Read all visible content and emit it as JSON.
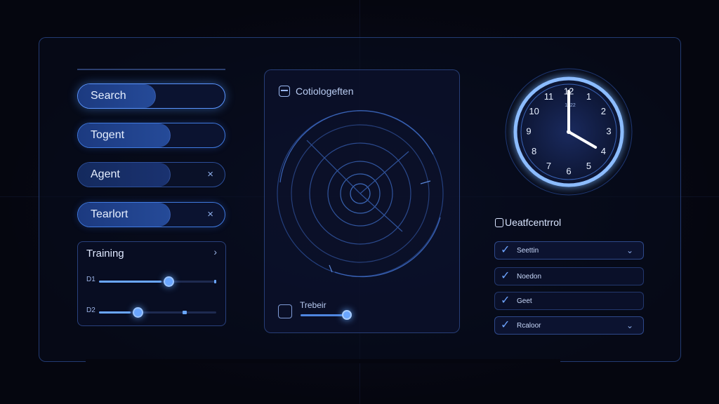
{
  "left": {
    "pills": [
      {
        "label": "Search",
        "fill_pct": 53,
        "close": ""
      },
      {
        "label": "Togent",
        "fill_pct": 63,
        "close": ""
      },
      {
        "label": "Agent",
        "fill_pct": 63,
        "close": "×"
      },
      {
        "label": "Tearlort",
        "fill_pct": 63,
        "close": "×"
      }
    ],
    "training": {
      "title": "Training",
      "chevron": "›",
      "sliders": [
        {
          "tag": "D1",
          "value_pct": 53
        },
        {
          "tag": "D2",
          "value_pct": 27
        }
      ]
    }
  },
  "center": {
    "header_icon": "window-icon",
    "header": "Cotiologeften",
    "footer_icon": "square-icon",
    "footer_label": "Trebeir",
    "footer_value_pct": 100
  },
  "clock": {
    "numerals": [
      "12",
      "1",
      "2",
      "3",
      "4",
      "5",
      "6",
      "7",
      "8",
      "9",
      "10",
      "11"
    ],
    "subtext": "1222",
    "hour": 4,
    "minute": 0
  },
  "tasks": {
    "title": "Ueatfcentrrol",
    "items": [
      {
        "label": "Seettin",
        "checked": true,
        "dropdown": "⌄"
      },
      {
        "label": "Noedon",
        "checked": true,
        "dropdown": ""
      },
      {
        "label": "Geet",
        "checked": true,
        "dropdown": ""
      },
      {
        "label": "Rcaloor",
        "checked": true,
        "dropdown": "⌄"
      }
    ]
  },
  "colors": {
    "accent": "#6aa6ff",
    "border": "#3f7ae0",
    "background": "#05060f"
  }
}
